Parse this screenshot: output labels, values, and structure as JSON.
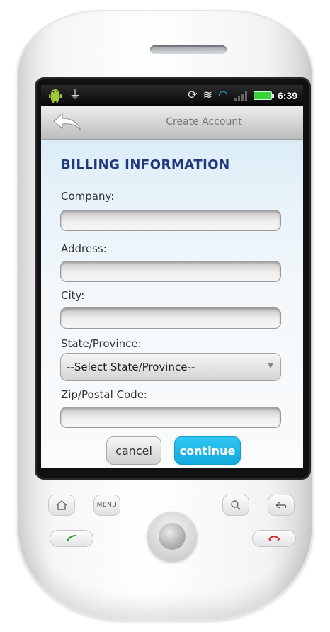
{
  "status_bar": {
    "icons": [
      "android-icon",
      "usb-icon",
      "sync-icon",
      "vibrate-icon",
      "wifi-icon",
      "signal-icon",
      "battery-icon"
    ],
    "time": "6:39"
  },
  "title_bar": {
    "title": "Create Account",
    "back_icon": "back-arrow-icon"
  },
  "form": {
    "heading": "BILLING INFORMATION",
    "fields": [
      {
        "label": "Company:",
        "value": "",
        "placeholder": ""
      },
      {
        "label": "Address:",
        "value": "",
        "placeholder": ""
      },
      {
        "label": "City:",
        "value": "",
        "placeholder": ""
      },
      {
        "label": "State/Province:",
        "selected": "--Select State/Province--"
      },
      {
        "label": "Zip/Postal Code:",
        "value": "",
        "placeholder": ""
      }
    ],
    "cancel_label": "cancel",
    "continue_label": "continue"
  },
  "hardware": {
    "menu_label": "MENU"
  },
  "colors": {
    "heading": "#213a7d",
    "continue": "#1fb6e8",
    "call": "#2aa02a",
    "end_call": "#d22b2b"
  }
}
